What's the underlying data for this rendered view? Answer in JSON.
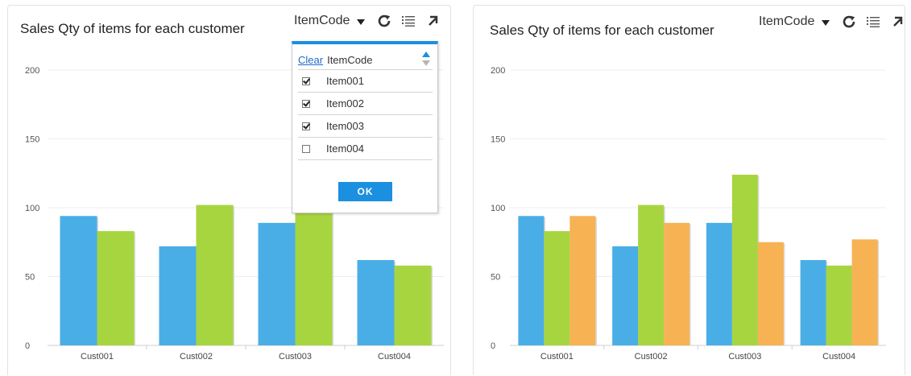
{
  "panels": [
    {
      "title": "Sales Qty of items for each customer",
      "toolbar": {
        "dropdown_label": "ItemCode"
      }
    },
    {
      "title": "Sales Qty of items for each customer",
      "toolbar": {
        "dropdown_label": "ItemCode"
      }
    }
  ],
  "filter_popup": {
    "clear_label": "Clear",
    "header_label": "ItemCode",
    "items": [
      {
        "label": "Item001",
        "checked": true
      },
      {
        "label": "Item002",
        "checked": true
      },
      {
        "label": "Item003",
        "checked": true
      },
      {
        "label": "Item004",
        "checked": false
      }
    ],
    "ok_label": "OK"
  },
  "colors": {
    "item001": "#4aaee6",
    "item002": "#a7d540",
    "item003": "#f7b254",
    "popup_accent": "#1b8fe0"
  },
  "chart_data": [
    {
      "type": "bar",
      "title": "Sales Qty of items for each customer",
      "categories": [
        "Cust001",
        "Cust002",
        "Cust003",
        "Cust004"
      ],
      "ylim": [
        0,
        200
      ],
      "yticks": [
        0,
        50,
        100,
        150,
        200
      ],
      "grid": true,
      "series": [
        {
          "values": [
            94,
            72,
            89,
            62
          ],
          "color": "#4aaee6"
        },
        {
          "values": [
            83,
            102,
            124,
            58
          ],
          "color": "#a7d540"
        }
      ]
    },
    {
      "type": "bar",
      "title": "Sales Qty of items for each customer",
      "categories": [
        "Cust001",
        "Cust002",
        "Cust003",
        "Cust004"
      ],
      "ylim": [
        0,
        200
      ],
      "yticks": [
        0,
        50,
        100,
        150,
        200
      ],
      "grid": true,
      "series": [
        {
          "values": [
            94,
            72,
            89,
            62
          ],
          "color": "#4aaee6"
        },
        {
          "values": [
            83,
            102,
            124,
            58
          ],
          "color": "#a7d540"
        },
        {
          "values": [
            94,
            89,
            75,
            77
          ],
          "color": "#f7b254"
        }
      ]
    }
  ]
}
